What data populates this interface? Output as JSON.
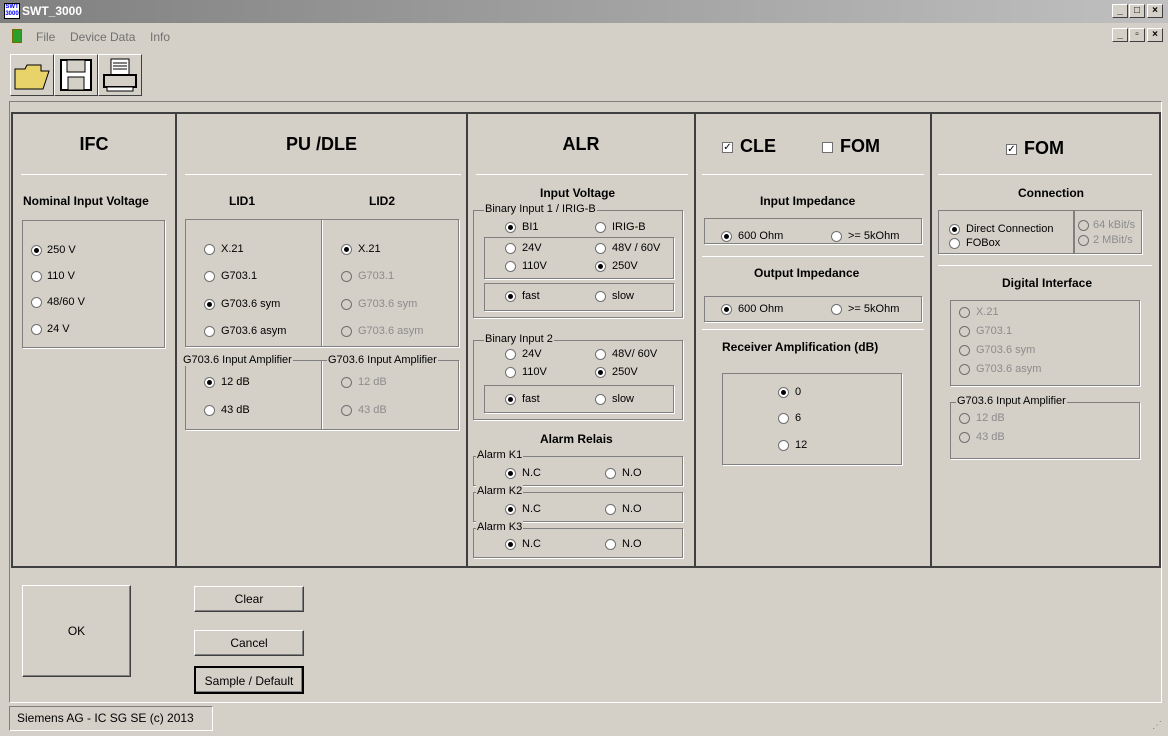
{
  "window": {
    "title": "SWT_3000",
    "icon_text": "SWT 3000"
  },
  "menu": {
    "file": "File",
    "device": "Device Data",
    "info": "Info"
  },
  "ifc": {
    "title": "IFC",
    "subtitle": "Nominal Input Voltage",
    "opts": [
      "250 V",
      "110 V",
      "48/60 V",
      "24 V"
    ]
  },
  "pu": {
    "title": "PU /DLE",
    "lid1": "LID1",
    "lid2": "LID2",
    "lid_opts": [
      "X.21",
      "G703.1",
      "G703.6 sym",
      "G703.6 asym"
    ],
    "amp_label": "G703.6 Input Amplifier",
    "amp_opts": [
      "12 dB",
      "43 dB"
    ]
  },
  "alr": {
    "title": "ALR",
    "input_voltage": "Input Voltage",
    "bi1": "Binary Input 1 / IRIG-B",
    "bi1_a": "BI1",
    "bi1_b": "IRIG-B",
    "v24": "24V",
    "v48": "48V / 60V",
    "v110": "110V",
    "v250": "250V",
    "fast": "fast",
    "slow": "slow",
    "bi2": "Binary Input 2",
    "v48b": "48V/ 60V",
    "alarm_relais": "Alarm Relais",
    "k1": "Alarm K1",
    "k2": "Alarm K2",
    "k3": "Alarm K3",
    "nc": "N.C",
    "no": "N.O"
  },
  "cle": {
    "cle": "CLE",
    "fom": "FOM",
    "in_imp": "Input Impedance",
    "out_imp": "Output Impedance",
    "ohm600": "600 Ohm",
    "ohm5k": ">= 5kOhm",
    "recv": "Receiver Amplification (dB)",
    "gains": [
      "0",
      "6",
      "12"
    ]
  },
  "fom": {
    "title": "FOM",
    "connection": "Connection",
    "direct": "Direct Connection",
    "fobox": "FOBox",
    "k64": "64 kBit/s",
    "m2": "2 MBit/s",
    "digital": "Digital Interface"
  },
  "buttons": {
    "ok": "OK",
    "clear": "Clear",
    "cancel": "Cancel",
    "sample": "Sample / Default"
  },
  "status": "Siemens AG - IC SG SE  (c) 2013"
}
